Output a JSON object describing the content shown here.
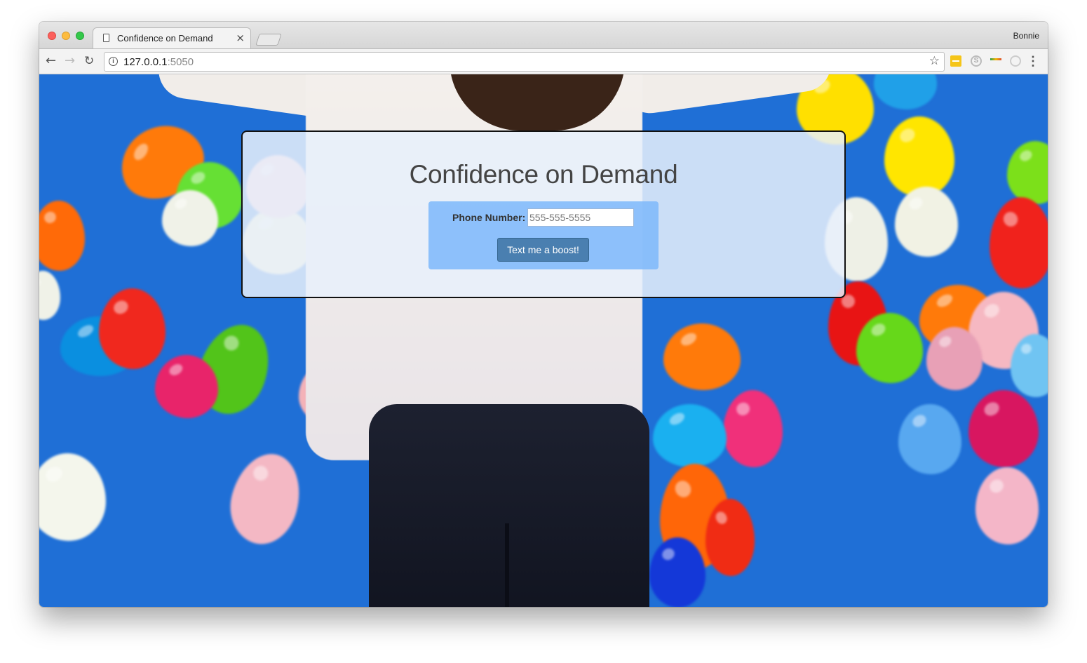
{
  "browser": {
    "tab_title": "Confidence on Demand",
    "tab_close_glyph": "×",
    "profile_name": "Bonnie",
    "url_host": "127.0.0.1",
    "url_port": ":5050",
    "icons": {
      "back": "←",
      "forward": "→",
      "reload": "↻",
      "star": "☆",
      "menu": "⋮",
      "info": "i",
      "skype": "S"
    }
  },
  "page": {
    "title": "Confidence on Demand",
    "phone_label": "Phone Number:",
    "phone_placeholder": "555-555-5555",
    "submit_label": "Text me a boost!"
  },
  "colors": {
    "sky": "#1f6fd6",
    "card_background": "#e8f0fc",
    "form_background": "#80b9fa",
    "button": "#4a7fb0"
  }
}
